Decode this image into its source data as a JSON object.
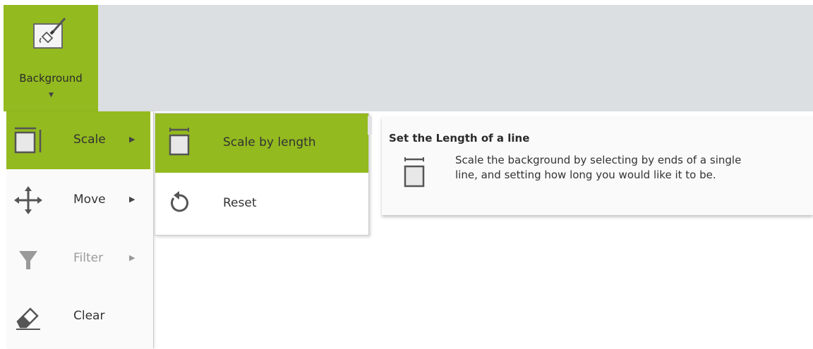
{
  "ribbon": {
    "background_button": {
      "label": "Background",
      "icon": "paint-bucket-brush-icon"
    }
  },
  "menu": {
    "items": [
      {
        "label": "Scale",
        "icon": "scale-icon",
        "has_submenu": true,
        "active": true
      },
      {
        "label": "Move",
        "icon": "move-arrows-icon",
        "has_submenu": true
      },
      {
        "label": "Filter",
        "icon": "filter-icon",
        "has_submenu": true,
        "disabled": true
      },
      {
        "label": "Clear",
        "icon": "eraser-icon",
        "has_submenu": false
      }
    ]
  },
  "submenu": {
    "items": [
      {
        "label": "Scale by length",
        "icon": "scale-by-length-icon",
        "active": true
      },
      {
        "label": "Reset",
        "icon": "reset-icon"
      }
    ]
  },
  "tooltip": {
    "title": "Set the Length of a line",
    "description_line1": "Scale the background by selecting by ends of a single",
    "description_line2": "line, and setting how long you would like it to be."
  },
  "colors": {
    "accent": "#93ba1f",
    "ribbon_bar": "#dcdfe2",
    "icon": "#555555"
  }
}
